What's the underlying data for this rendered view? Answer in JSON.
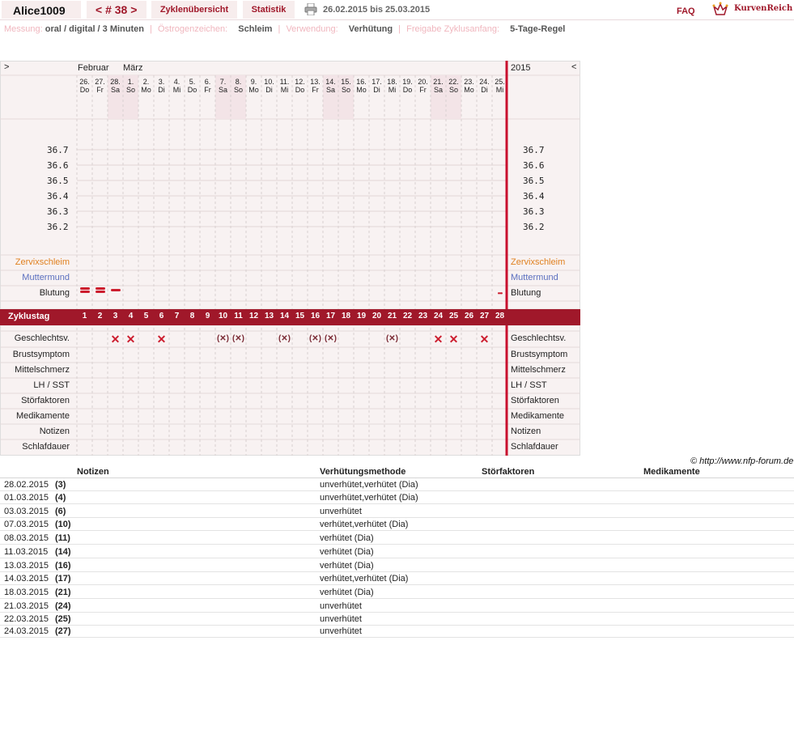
{
  "header": {
    "user": "Alice1009",
    "cycle_nav": "< # 38 >",
    "tab_overview": "Zyklenübersicht",
    "tab_stats": "Statistik",
    "date_range": "26.02.2015 bis 25.03.2015",
    "faq": "FAQ",
    "brand": "KurvenReich"
  },
  "settings": {
    "measure_label": "Messung:",
    "measure_value": "oral / digital / 3 Minuten",
    "estrogen_label": "Östrogenzeichen:",
    "estrogen_value": "Schleim",
    "usage_label": "Verwendung:",
    "usage_value": "Verhütung",
    "release_label": "Freigabe Zyklusanfang:",
    "release_value": "5-Tage-Regel"
  },
  "chart": {
    "nav_left": ">",
    "nav_right": "<",
    "year": "2015",
    "month_feb": "Februar",
    "month_mar": "März",
    "days": [
      {
        "d": "26.",
        "w": "Do"
      },
      {
        "d": "27.",
        "w": "Fr"
      },
      {
        "d": "28.",
        "w": "Sa"
      },
      {
        "d": "1.",
        "w": "So"
      },
      {
        "d": "2.",
        "w": "Mo"
      },
      {
        "d": "3.",
        "w": "Di"
      },
      {
        "d": "4.",
        "w": "Mi"
      },
      {
        "d": "5.",
        "w": "Do"
      },
      {
        "d": "6.",
        "w": "Fr"
      },
      {
        "d": "7.",
        "w": "Sa"
      },
      {
        "d": "8.",
        "w": "So"
      },
      {
        "d": "9.",
        "w": "Mo"
      },
      {
        "d": "10.",
        "w": "Di"
      },
      {
        "d": "11.",
        "w": "Mi"
      },
      {
        "d": "12.",
        "w": "Do"
      },
      {
        "d": "13.",
        "w": "Fr"
      },
      {
        "d": "14.",
        "w": "Sa"
      },
      {
        "d": "15.",
        "w": "So"
      },
      {
        "d": "16.",
        "w": "Mo"
      },
      {
        "d": "17.",
        "w": "Di"
      },
      {
        "d": "18.",
        "w": "Mi"
      },
      {
        "d": "19.",
        "w": "Do"
      },
      {
        "d": "20.",
        "w": "Fr"
      },
      {
        "d": "21.",
        "w": "Sa"
      },
      {
        "d": "22.",
        "w": "So"
      },
      {
        "d": "23.",
        "w": "Mo"
      },
      {
        "d": "24.",
        "w": "Di"
      },
      {
        "d": "25.",
        "w": "Mi"
      }
    ],
    "temp_ticks": [
      "36.7",
      "36.6",
      "36.5",
      "36.4",
      "36.3",
      "36.2"
    ],
    "row_labels": {
      "zervix": "Zervixschleim",
      "muttermund": "Muttermund",
      "blutung": "Blutung",
      "zyklustag": "Zyklustag",
      "geschlecht": "Geschlechtsv.",
      "brust": "Brustsymptom",
      "mittel": "Mittelschmerz",
      "lh": "LH / SST",
      "stoer": "Störfaktoren",
      "medi": "Medikamente",
      "notizen": "Notizen",
      "schlaf": "Schlafdauer"
    },
    "cycle_days": [
      "1",
      "2",
      "3",
      "4",
      "5",
      "6",
      "7",
      "8",
      "9",
      "10",
      "11",
      "12",
      "13",
      "14",
      "15",
      "16",
      "17",
      "18",
      "19",
      "20",
      "21",
      "22",
      "23",
      "24",
      "25",
      "26",
      "27",
      "28"
    ],
    "intercourse": {
      "unprotected_x": [
        "3",
        "4",
        "6",
        "24",
        "25",
        "27"
      ],
      "protected_paren_x": [
        "10",
        "11",
        "14",
        "16",
        "17",
        "21"
      ],
      "x_symbol": "✕",
      "paren_symbol": "(✕)"
    },
    "bleeding_days": [
      "1",
      "2",
      "3",
      "28"
    ]
  },
  "copyright": "© http://www.nfp-forum.de",
  "table": {
    "headers": [
      "Notizen",
      "Verhütungsmethode",
      "Störfaktoren",
      "Medikamente"
    ],
    "rows": [
      {
        "date": "28.02.2015",
        "day": "(3)",
        "method": "unverhütet,verhütet (Dia)"
      },
      {
        "date": "01.03.2015",
        "day": "(4)",
        "method": "unverhütet,verhütet (Dia)"
      },
      {
        "date": "03.03.2015",
        "day": "(6)",
        "method": "unverhütet"
      },
      {
        "date": "07.03.2015",
        "day": "(10)",
        "method": "verhütet,verhütet (Dia)"
      },
      {
        "date": "08.03.2015",
        "day": "(11)",
        "method": "verhütet (Dia)"
      },
      {
        "date": "11.03.2015",
        "day": "(14)",
        "method": "verhütet (Dia)"
      },
      {
        "date": "13.03.2015",
        "day": "(16)",
        "method": "verhütet (Dia)"
      },
      {
        "date": "14.03.2015",
        "day": "(17)",
        "method": "verhütet,verhütet (Dia)"
      },
      {
        "date": "18.03.2015",
        "day": "(21)",
        "method": "verhütet (Dia)"
      },
      {
        "date": "21.03.2015",
        "day": "(24)",
        "method": "unverhütet"
      },
      {
        "date": "22.03.2015",
        "day": "(25)",
        "method": "unverhütet"
      },
      {
        "date": "24.03.2015",
        "day": "(27)",
        "method": "unverhütet"
      }
    ]
  },
  "colors": {
    "accent": "#a0182a",
    "zervix": "#e0801f",
    "muttermund": "#5a6fbf",
    "weekend": "#f3e4e7",
    "chartbg": "#f8f2f2"
  }
}
